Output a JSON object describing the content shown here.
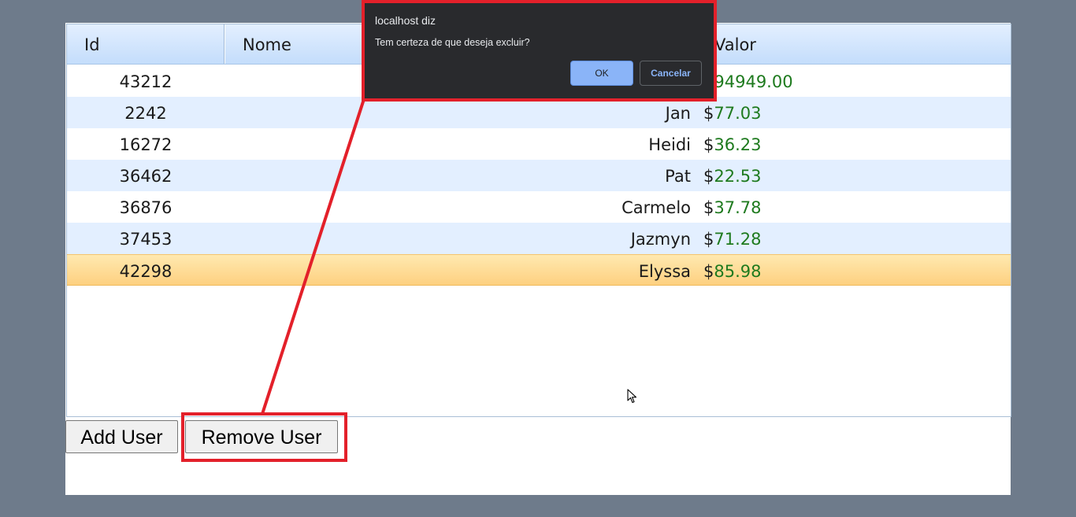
{
  "grid": {
    "columns": [
      "Id",
      "Nome",
      "Valor"
    ],
    "currency_symbol": "$",
    "rows": [
      {
        "id": "43212",
        "nome": "",
        "valor": "94949.00"
      },
      {
        "id": "2242",
        "nome": "Jan",
        "valor": "77.03"
      },
      {
        "id": "16272",
        "nome": "Heidi",
        "valor": "36.23"
      },
      {
        "id": "36462",
        "nome": "Pat",
        "valor": "22.53"
      },
      {
        "id": "36876",
        "nome": "Carmelo",
        "valor": "37.78"
      },
      {
        "id": "37453",
        "nome": "Jazmyn",
        "valor": "71.28"
      },
      {
        "id": "42298",
        "nome": "Elyssa",
        "valor": "85.98"
      }
    ],
    "selected_row": 6
  },
  "buttons": {
    "add_user": "Add User",
    "remove_user": "Remove User"
  },
  "dialog": {
    "title": "localhost diz",
    "message": "Tem certeza de que deseja excluir?",
    "ok_label": "OK",
    "cancel_label": "Cancelar"
  },
  "colors": {
    "annotation": "#e3202a",
    "money": "#1e7a1e",
    "selected_row": "#fdd080",
    "alt_row": "#e3efff",
    "dialog_bg": "#292a2d",
    "ok_button": "#8ab4f8"
  },
  "icons": {
    "cursor": "mouse-pointer-icon"
  }
}
